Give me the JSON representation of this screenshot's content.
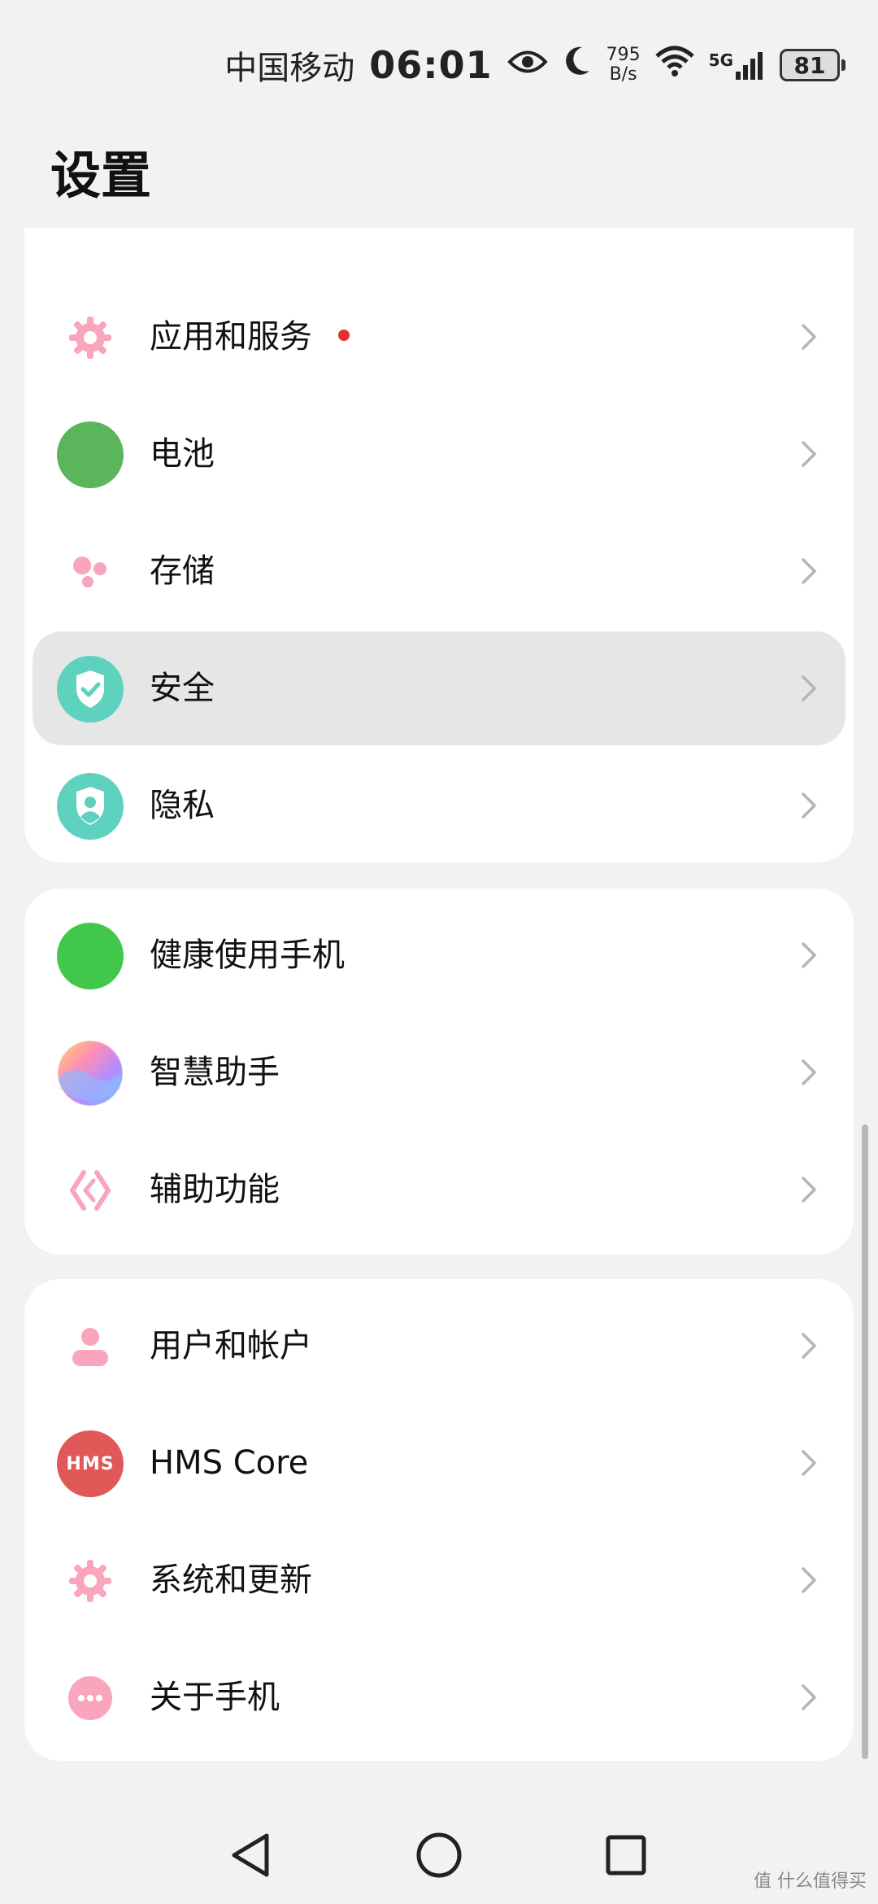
{
  "status": {
    "carrier": "中国移动",
    "time": "06:01",
    "speed_value": "795",
    "speed_unit": "B/s",
    "network": "5G",
    "battery": "81"
  },
  "title": "设置",
  "card1": [
    {
      "label": "应用和服务",
      "icon": "gear-icon",
      "badge": true
    },
    {
      "label": "电池",
      "icon": "battery-icon"
    },
    {
      "label": "存储",
      "icon": "storage-icon"
    },
    {
      "label": "安全",
      "icon": "shield-check-icon",
      "selected": true
    },
    {
      "label": "隐私",
      "icon": "privacy-shield-icon"
    }
  ],
  "card2": [
    {
      "label": "健康使用手机",
      "icon": "digital-balance-icon"
    },
    {
      "label": "智慧助手",
      "icon": "assistant-orb-icon"
    },
    {
      "label": "辅助功能",
      "icon": "accessibility-icon"
    }
  ],
  "card3": [
    {
      "label": "用户和帐户",
      "icon": "user-icon"
    },
    {
      "label": "HMS Core",
      "icon": "hms-core-icon",
      "icon_text": "HMS"
    },
    {
      "label": "系统和更新",
      "icon": "gear-icon"
    },
    {
      "label": "关于手机",
      "icon": "more-dots-icon"
    }
  ],
  "watermark": "值 什么值得买",
  "colors": {
    "accent_pink": "#f8a5bd",
    "green_battery": "#5bb65b",
    "green_health": "#41c84a",
    "teal": "#5ed1bf",
    "hms_red": "#e05858",
    "badge_red": "#e53030"
  }
}
